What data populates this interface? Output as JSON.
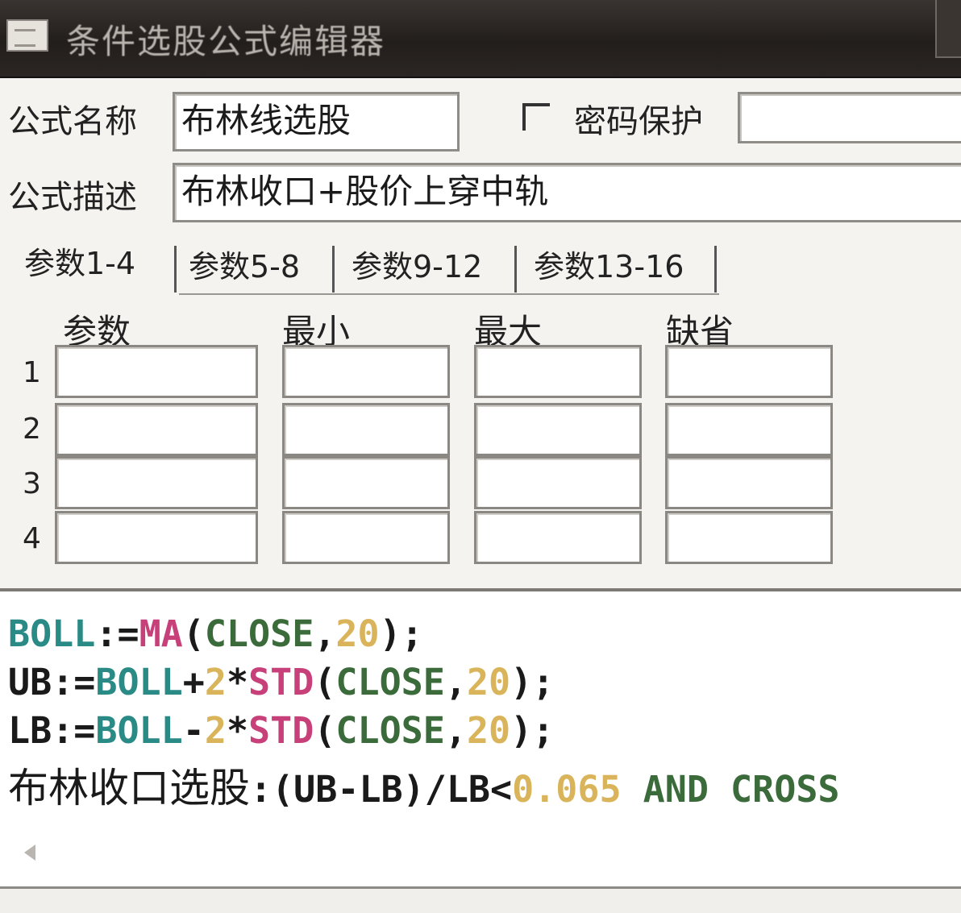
{
  "window": {
    "title": "条件选股公式编辑器"
  },
  "form": {
    "name_label": "公式名称",
    "name_value": "布林线选股",
    "password_label": "密码保护",
    "password_value": "",
    "desc_label": "公式描述",
    "desc_value": "布林收口+股价上穿中轨"
  },
  "tabs": [
    {
      "label": "参数1-4",
      "active": true
    },
    {
      "label": "参数5-8",
      "active": false
    },
    {
      "label": "参数9-12",
      "active": false
    },
    {
      "label": "参数13-16",
      "active": false
    }
  ],
  "params": {
    "headers": [
      "参数",
      "最小",
      "最大",
      "缺省"
    ],
    "rows": [
      {
        "num": "1",
        "cells": [
          "",
          "",
          "",
          ""
        ]
      },
      {
        "num": "2",
        "cells": [
          "",
          "",
          "",
          ""
        ]
      },
      {
        "num": "3",
        "cells": [
          "",
          "",
          "",
          ""
        ]
      },
      {
        "num": "4",
        "cells": [
          "",
          "",
          "",
          ""
        ]
      }
    ]
  },
  "code": {
    "line1": {
      "a": "BOLL",
      "b": ":=",
      "c": "MA",
      "d": "(",
      "e": "CLOSE",
      "f": ",",
      "g": "20",
      "h": ");"
    },
    "line2": {
      "a": "UB",
      "b": ":=",
      "c": "BOLL",
      "d": "+",
      "e": "2",
      "f": "*",
      "g": "STD",
      "h": "(",
      "i": "CLOSE",
      "j": ",",
      "k": "20",
      "l": ");"
    },
    "line3": {
      "a": "LB",
      "b": ":=",
      "c": "BOLL",
      "d": "-",
      "e": "2",
      "f": "*",
      "g": "STD",
      "h": "(",
      "i": "CLOSE",
      "j": ",",
      "k": "20",
      "l": ");"
    },
    "line4": {
      "a": "布林收口选股",
      "b": ":(UB-LB)/LB<",
      "c": "0.065",
      "d": " AND ",
      "e": "CROSS"
    }
  },
  "colors": {
    "keyword_teal": "#2a8a86",
    "function_pink": "#c8407a",
    "arg_green": "#3b6b3b",
    "number_gold": "#d9b45a"
  },
  "status": {
    "text": ""
  }
}
